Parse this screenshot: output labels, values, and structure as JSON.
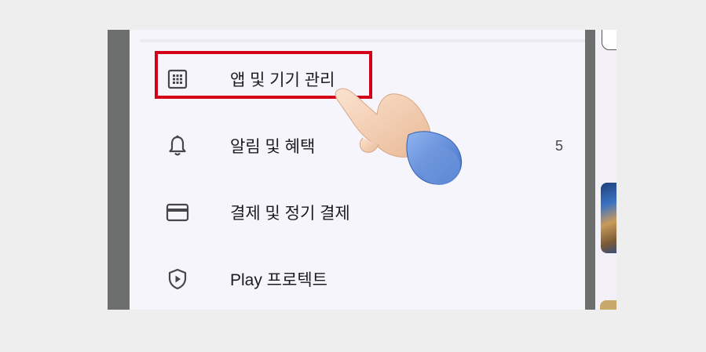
{
  "menu": {
    "items": [
      {
        "label": "앱 및 기기 관리",
        "icon": "apps-grid-icon",
        "highlighted": true
      },
      {
        "label": "알림 및 혜택",
        "icon": "bell-icon",
        "count": "5"
      },
      {
        "label": "결제 및 정기 결제",
        "icon": "credit-card-icon"
      },
      {
        "label": "Play 프로텍트",
        "icon": "shield-play-icon"
      }
    ]
  },
  "colors": {
    "highlight_border": "#d4001a",
    "drawer_background": "#f7f5fc",
    "page_background": "#edeeed",
    "screen_background": "#6d6e6e"
  }
}
